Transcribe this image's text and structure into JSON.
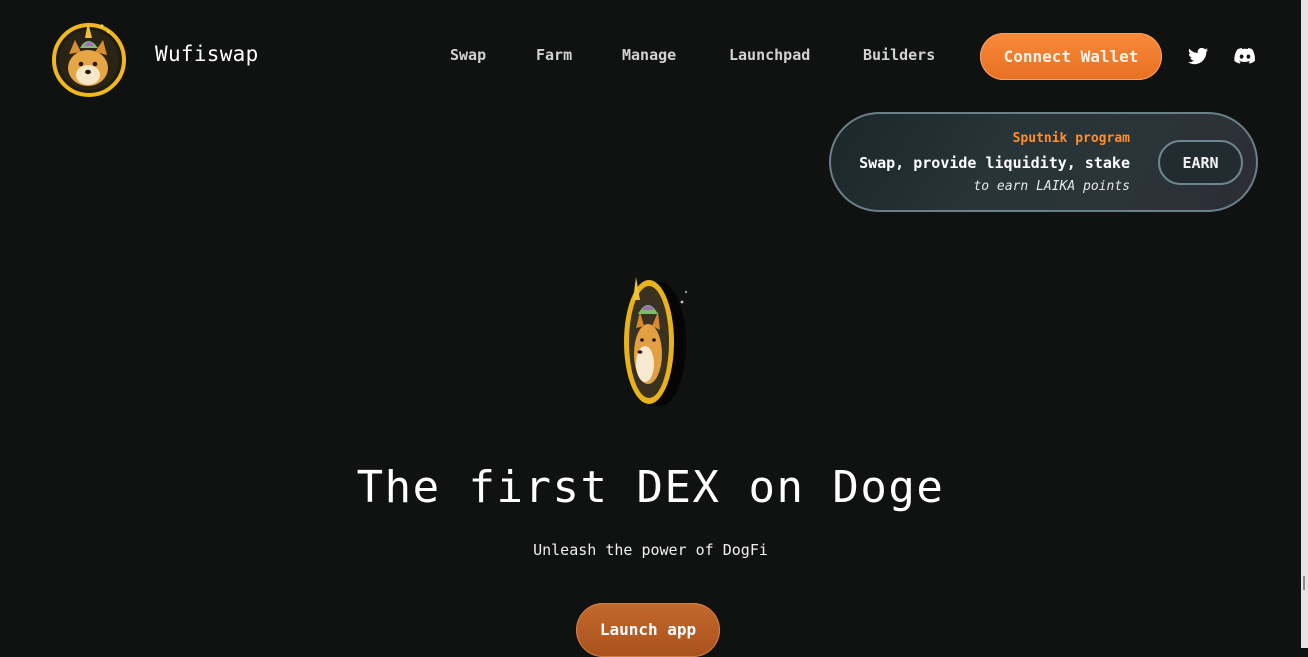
{
  "header": {
    "brand": "Wufiswap",
    "logo_icon": "doge-unicorn-logo-icon",
    "nav": [
      {
        "label": "Swap"
      },
      {
        "label": "Farm"
      },
      {
        "label": "Manage"
      },
      {
        "label": "Launchpad"
      },
      {
        "label": "Builders"
      }
    ],
    "connect_label": "Connect Wallet",
    "social": [
      "twitter-icon",
      "discord-icon"
    ]
  },
  "promo": {
    "kicker": "Sputnik program",
    "main": "Swap, provide liquidity, stake",
    "sub": "to earn LAIKA points",
    "button": "EARN"
  },
  "hero": {
    "title": "The first DEX on Doge",
    "subtitle": "Unleash the power of DogFi",
    "cta": "Launch app",
    "coin_icon": "doge-coin-icon"
  },
  "colors": {
    "background": "#101111",
    "accent": "#f88a3a",
    "promo_kicker": "#ff8f2e",
    "launch_button": "#b95f25"
  }
}
